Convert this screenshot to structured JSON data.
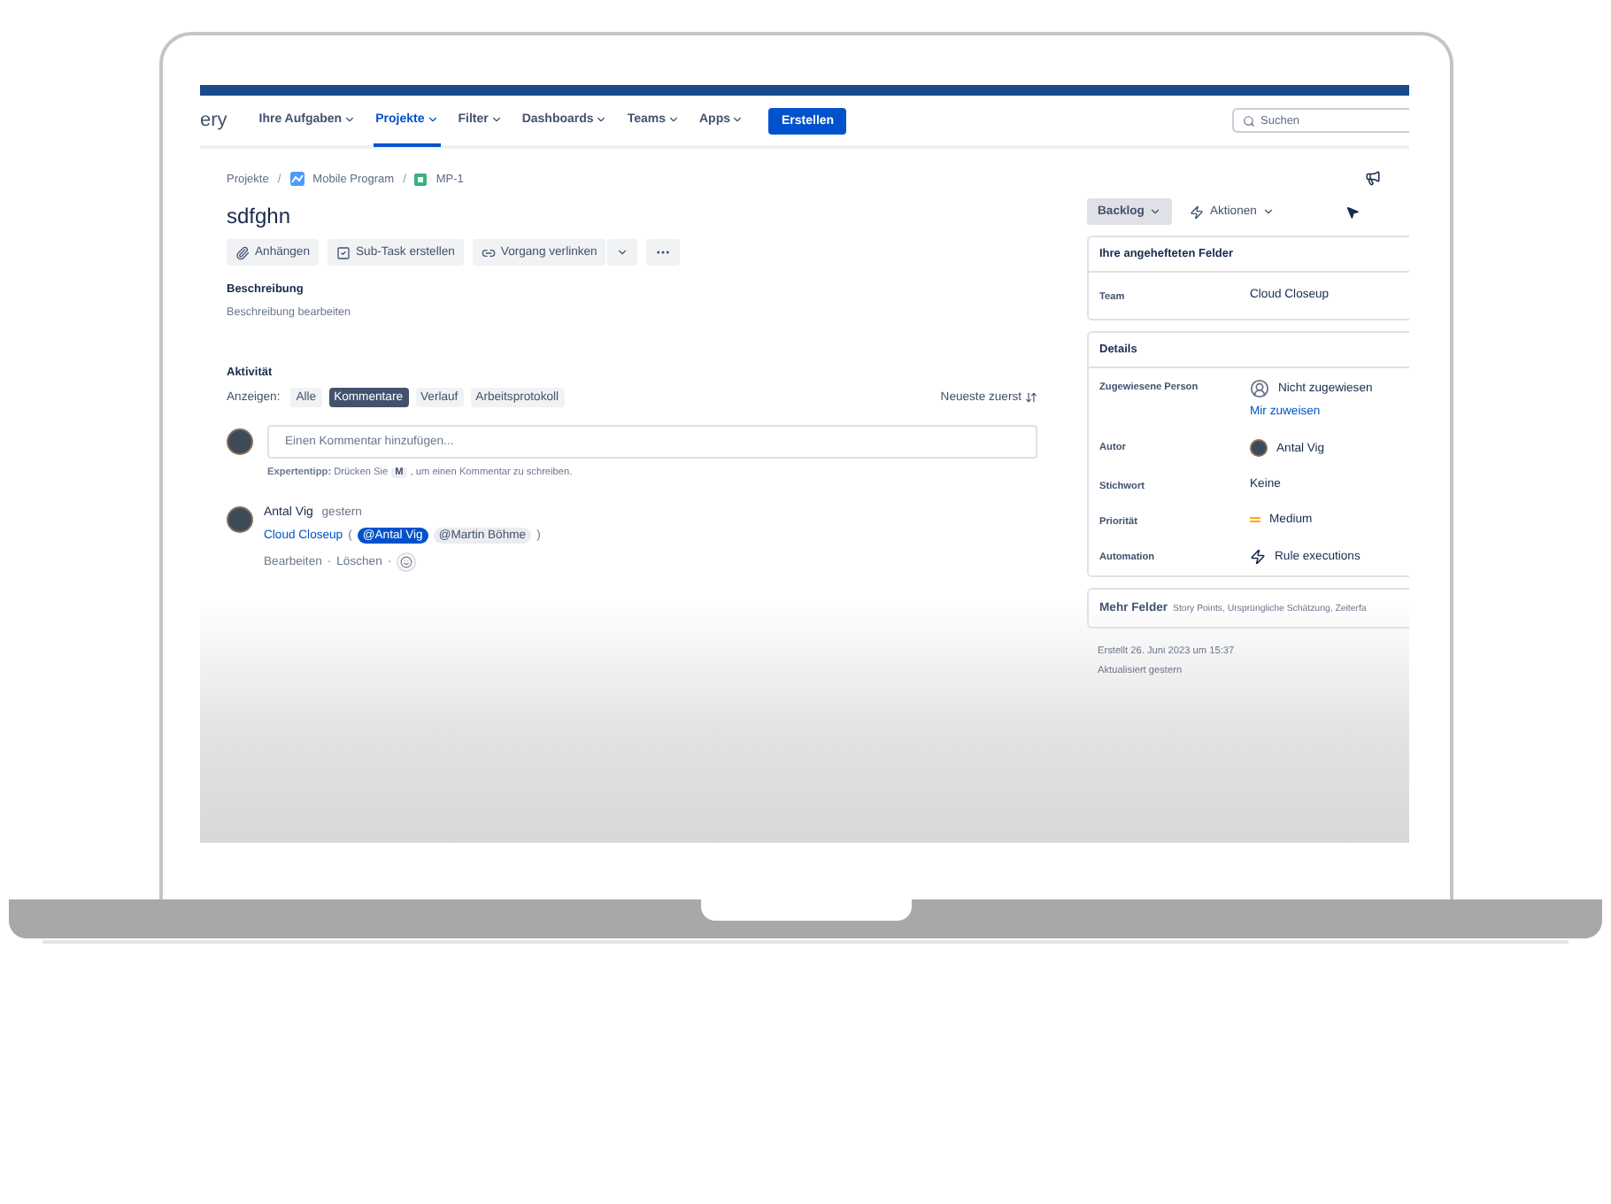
{
  "nav": {
    "logo_text": "ery",
    "items": [
      {
        "label": "Ihre Aufgaben",
        "selected": false
      },
      {
        "label": "Projekte",
        "selected": true
      },
      {
        "label": "Filter",
        "selected": false
      },
      {
        "label": "Dashboards",
        "selected": false
      },
      {
        "label": "Teams",
        "selected": false
      },
      {
        "label": "Apps",
        "selected": false
      }
    ],
    "create_button": "Erstellen",
    "search": {
      "placeholder": "Suchen"
    }
  },
  "breadcrumb_separator": "/",
  "breadcrumbs": [
    {
      "label": "Projekte",
      "kind": "text"
    },
    {
      "label": "Mobile Program",
      "kind": "project"
    },
    {
      "label": "MP-1",
      "kind": "issue"
    }
  ],
  "issue_title": "sdfghn",
  "actions": [
    {
      "label": "Anhängen",
      "kind": "attach"
    },
    {
      "label": "Sub-Task erstellen",
      "kind": "subtask"
    },
    {
      "label": "Vorgang verlinken",
      "kind": "link"
    }
  ],
  "description": {
    "heading": "Beschreibung",
    "placeholder": "Beschreibung bearbeiten"
  },
  "activity": {
    "heading": "Aktivität",
    "filter_label": "Anzeigen:",
    "filters": [
      {
        "label": "Alle",
        "selected": false
      },
      {
        "label": "Kommentare",
        "selected": true
      },
      {
        "label": "Verlauf",
        "selected": false
      },
      {
        "label": "Arbeitsprotokoll",
        "selected": false
      }
    ],
    "sort": "Neueste zuerst",
    "comment_box": {
      "placeholder": "Einen Kommentar hinzufügen..."
    },
    "tip": {
      "label": "Expertentipp:",
      "before": "Drücken Sie",
      "key": "M",
      "after": ", um einen Kommentar zu schreiben."
    },
    "comments": [
      {
        "author": "Antal Vig",
        "time": "gestern",
        "link": "Cloud Closeup",
        "open_paren": "(",
        "mentions": [
          {
            "label": "@Antal Vig",
            "selected": true
          },
          {
            "label": "@Martin Böhme",
            "selected": false
          }
        ],
        "close_paren": ")",
        "actions": [
          "Bearbeiten",
          "Löschen"
        ],
        "separator": "·"
      }
    ]
  },
  "status_button": "Backlog",
  "actions_menu": "Aktionen",
  "pinned": {
    "heading": "Ihre angehefteten Felder",
    "fields": [
      {
        "label": "Team",
        "value": "Cloud Closeup"
      }
    ]
  },
  "details": {
    "heading": "Details",
    "fields": [
      {
        "label": "Zugewiesene Person",
        "value": "Nicht zugewiesen",
        "kind": "unassigned",
        "link": "Mir zuweisen"
      },
      {
        "label": "Autor",
        "value": "Antal Vig",
        "kind": "avatar"
      },
      {
        "label": "Stichwort",
        "value": "Keine",
        "kind": "text"
      },
      {
        "label": "Priorität",
        "value": "Medium",
        "kind": "priority"
      },
      {
        "label": "Automation",
        "value": "Rule executions",
        "kind": "automation"
      }
    ]
  },
  "more_fields": {
    "label": "Mehr Felder",
    "summary": "Story Points, Ursprüngliche Schätzung, Zeiterfa"
  },
  "created": "Erstellt 26. Juni 2023 um 15:37",
  "updated": "Aktualisiert gestern"
}
